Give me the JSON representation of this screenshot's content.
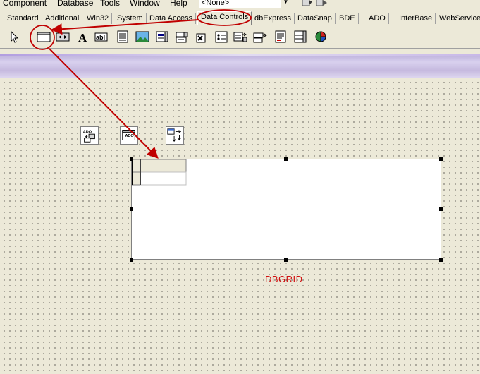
{
  "menu": {
    "items": [
      "Component",
      "Database",
      "Tools",
      "Window",
      "Help"
    ],
    "combo_value": "<None>"
  },
  "tabs": [
    "Standard",
    "Additional",
    "Win32",
    "System",
    "Data Access",
    "Data Controls",
    "dbExpress",
    "DataSnap",
    "BDE",
    "ADO",
    "InterBase",
    "WebServices"
  ],
  "active_tab": "Data Controls",
  "palette_icons": [
    "pointer-icon",
    "dbgrid-icon",
    "dbnavigator-icon",
    "dbtext-icon",
    "dbedit-icon",
    "dbmemo-icon",
    "dbimage-icon",
    "dblistbox-icon",
    "dbcombobox-icon",
    "dbcheckbox-icon",
    "dbradiogroup-icon",
    "dblookuplistbox-icon",
    "dblookupcombobox-icon",
    "dbrichedit-icon",
    "dbctrlgrid-icon",
    "dbchart-icon"
  ],
  "form": {
    "component_icons": [
      "ado-connection-icon",
      "ado-dataset-icon",
      "datasource-icon"
    ],
    "grid_caption": "DBGRID"
  },
  "colors": {
    "annotation": "#C00000",
    "caption": "#D01010",
    "face": "#ECE9D8"
  }
}
